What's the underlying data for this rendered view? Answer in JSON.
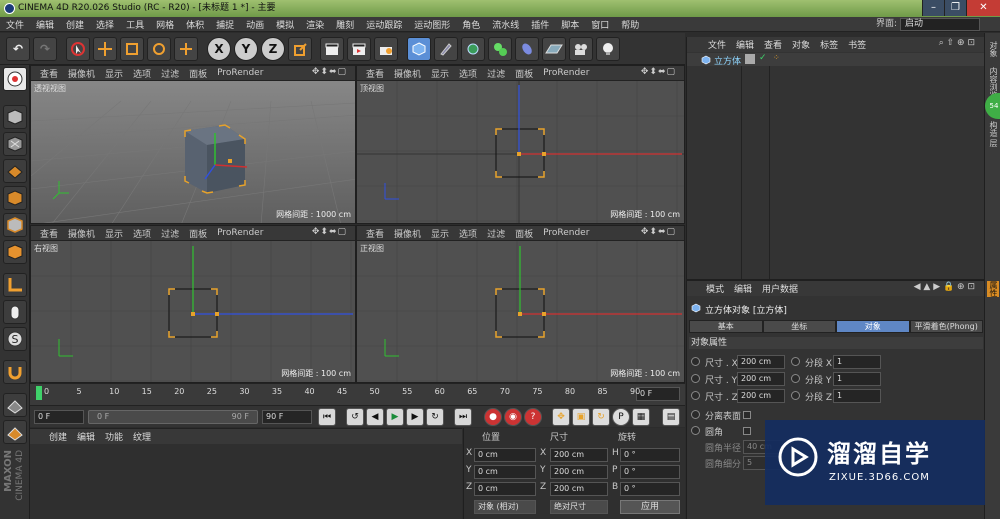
{
  "window": {
    "title": "CINEMA 4D R20.026 Studio (RC - R20) - [未标题 1 *] - 主要",
    "controls": [
      "–",
      "❐",
      "✕"
    ]
  },
  "menubar": {
    "items": [
      "文件",
      "编辑",
      "创建",
      "选择",
      "工具",
      "网格",
      "体积",
      "捕捉",
      "动画",
      "模拟",
      "渲染",
      "雕刻",
      "运动跟踪",
      "运动图形",
      "角色",
      "流水线",
      "插件",
      "脚本",
      "窗口",
      "帮助"
    ],
    "layout_label": "界面:",
    "layout_value": "启动"
  },
  "toolbar": {
    "undo": "↶",
    "redo": "↷",
    "x": "X",
    "y": "Y",
    "z": "Z"
  },
  "viewport_menu": [
    "查看",
    "摄像机",
    "显示",
    "选项",
    "过滤",
    "面板",
    "ProRender"
  ],
  "viewports": [
    {
      "label": "透视视图",
      "grid": "网格间距 : 1000 cm"
    },
    {
      "label": "顶视图",
      "grid": "网格间距 : 100 cm"
    },
    {
      "label": "右视图",
      "grid": "网格间距 : 100 cm"
    },
    {
      "label": "正视图",
      "grid": "网格间距 : 100 cm"
    }
  ],
  "axis_labels": {
    "x": "X",
    "y": "Y",
    "z": "Z"
  },
  "timeline": {
    "ticks": [
      "0",
      "5",
      "10",
      "15",
      "20",
      "25",
      "30",
      "35",
      "40",
      "45",
      "50",
      "55",
      "60",
      "65",
      "70",
      "75",
      "80",
      "85",
      "90"
    ],
    "current_frame": "0 F"
  },
  "playbar": {
    "start": "0 F",
    "range_start": "0 F",
    "range_end": "90 F",
    "end": "90 F"
  },
  "material_panel": {
    "menu": [
      "创建",
      "编辑",
      "功能",
      "纹理"
    ]
  },
  "coord_panel": {
    "headers": [
      "位置",
      "尺寸",
      "旋转"
    ],
    "rows": [
      {
        "axis": "X",
        "pos": "0 cm",
        "size_axis": "X",
        "size": "200 cm",
        "rot_axis": "H",
        "rot": "0 °"
      },
      {
        "axis": "Y",
        "pos": "0 cm",
        "size_axis": "Y",
        "size": "200 cm",
        "rot_axis": "P",
        "rot": "0 °"
      },
      {
        "axis": "Z",
        "pos": "0 cm",
        "size_axis": "Z",
        "size": "200 cm",
        "rot_axis": "B",
        "rot": "0 °"
      }
    ],
    "mode_select": "对象 (相对)",
    "size_select": "绝对尺寸",
    "apply_button": "应用"
  },
  "object_panel": {
    "menu": [
      "文件",
      "编辑",
      "查看",
      "对象",
      "标签",
      "书签"
    ],
    "objects": [
      {
        "name": "立方体"
      }
    ]
  },
  "attr_panel": {
    "menu": [
      "模式",
      "编辑",
      "用户数据"
    ],
    "title": "立方体对象 [立方体]",
    "tabs": [
      "基本",
      "坐标",
      "对象",
      "平滑着色(Phong)"
    ],
    "active_tab": 2,
    "section": "对象属性",
    "size_rows": [
      {
        "label": "尺寸 . X",
        "value": "200 cm",
        "seg_label": "分段 X",
        "seg": "1"
      },
      {
        "label": "尺寸 . Y",
        "value": "200 cm",
        "seg_label": "分段 Y",
        "seg": "1"
      },
      {
        "label": "尺寸 . Z",
        "value": "200 cm",
        "seg_label": "分段 Z",
        "seg": "1"
      }
    ],
    "separate": "分离表面",
    "fillet": "圆角",
    "fillet_radius_label": "圆角半径",
    "fillet_radius": "40 cm",
    "fillet_sub_label": "圆角细分",
    "fillet_sub": "5"
  },
  "right_strip": {
    "tabs": [
      "对象",
      "内容浏览器",
      "构造",
      "层",
      "属性"
    ]
  },
  "left_logo": {
    "brand1": "MAXON",
    "brand2": "CINEMA 4D"
  },
  "watermark": {
    "title": "溜溜自学",
    "url": "ZIXUE.3D66.COM"
  },
  "colors": {
    "accent": "#5f87c5",
    "x_axis": "#d03030",
    "y_axis": "#30c030",
    "z_axis": "#3050e0",
    "selection": "#e7a22a"
  }
}
